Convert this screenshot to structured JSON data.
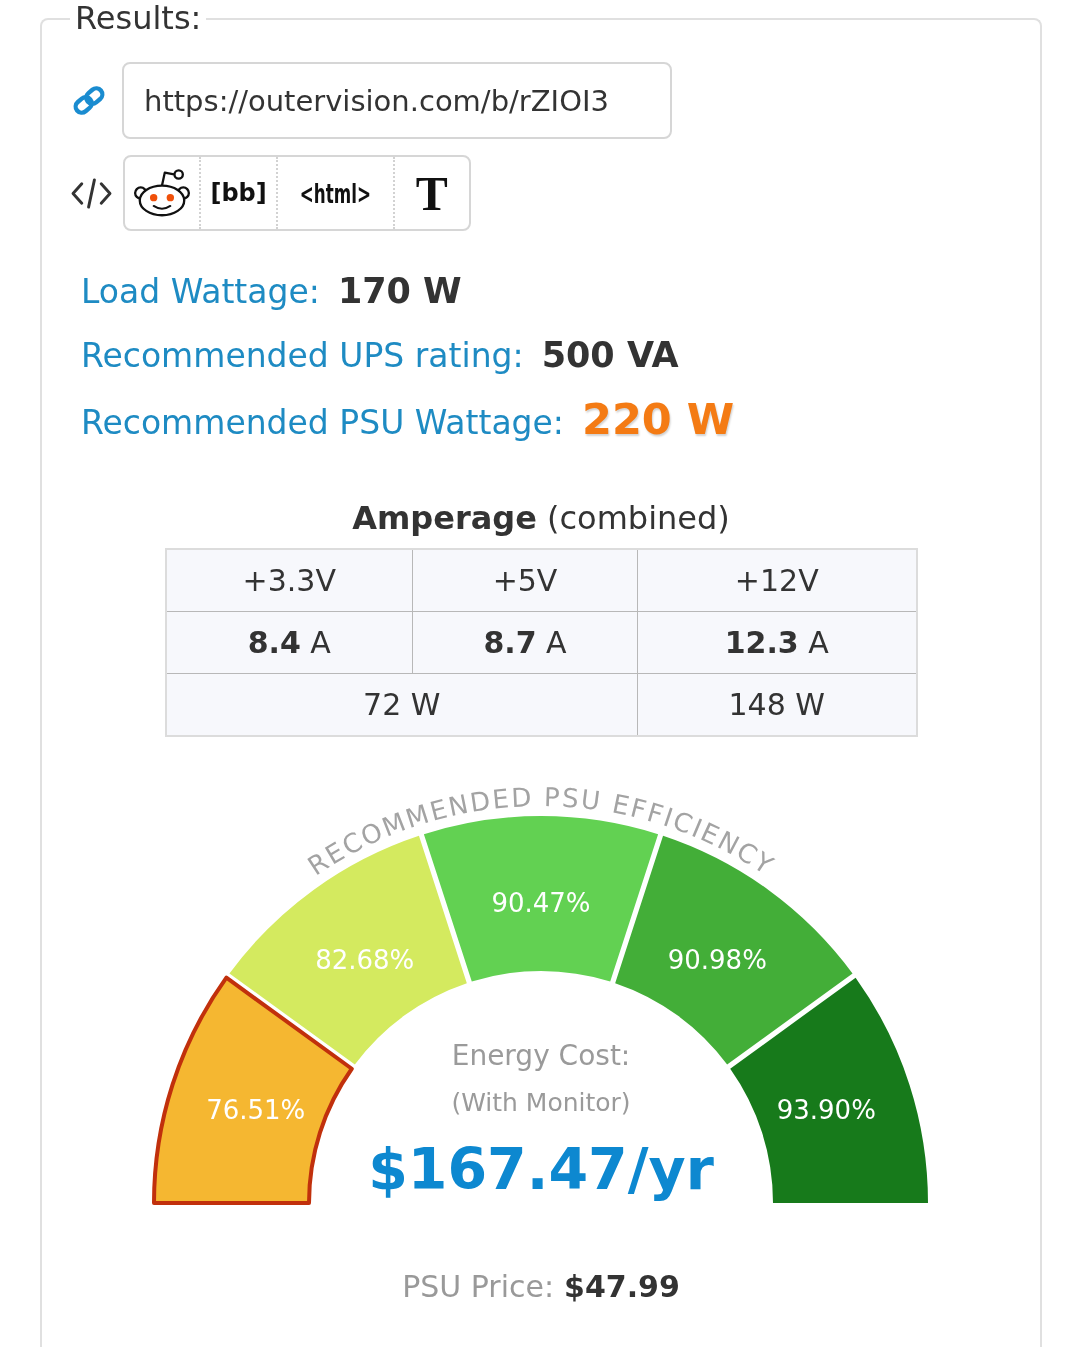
{
  "panel": {
    "title": "Results:"
  },
  "share_link": {
    "url": "https://outervision.com/b/rZIOI3"
  },
  "embed_buttons": [
    {
      "kind": "icon"
    },
    {
      "kind": "bold",
      "label": "[bb]"
    },
    {
      "kind": "condensed",
      "label": "<html>"
    },
    {
      "kind": "serif",
      "label": "T"
    }
  ],
  "stats": [
    {
      "label": "Load Wattage:",
      "value": "170 W",
      "kind": "plain"
    },
    {
      "label": "Recommended UPS rating:",
      "value": "500 VA",
      "kind": "plain"
    },
    {
      "label": "Recommended PSU Wattage:",
      "value": "220 W",
      "kind": "highlight"
    }
  ],
  "amperage": {
    "title": "**Amperage** (combined)",
    "rails": [
      "+3.3V",
      "+5V",
      "+12V"
    ],
    "currents": [
      "**8.4** A",
      "**8.7** A",
      "**12.3** A"
    ],
    "watts": [
      {
        "text": "72 W",
        "kind": "merged"
      },
      {
        "text": "148 W",
        "kind": "single"
      }
    ]
  },
  "efficiency_gauge": {
    "title": "RECOMMENDED PSU EFFICIENCY",
    "segments": [
      {
        "label": "76.51%",
        "color": "#f5b731",
        "selected": true
      },
      {
        "label": "82.68%",
        "color": "#d4ea5f",
        "selected": false
      },
      {
        "label": "90.47%",
        "color": "#62d152",
        "selected": false
      },
      {
        "label": "90.98%",
        "color": "#43ae38",
        "selected": false
      },
      {
        "label": "93.90%",
        "color": "#177a1b",
        "selected": false
      }
    ],
    "cost_label": "Energy Cost:",
    "cost_note": "(With Monitor)",
    "cost_value": "$167.47/yr"
  },
  "price": {
    "label": "PSU Price:",
    "value": "$47.99"
  }
}
